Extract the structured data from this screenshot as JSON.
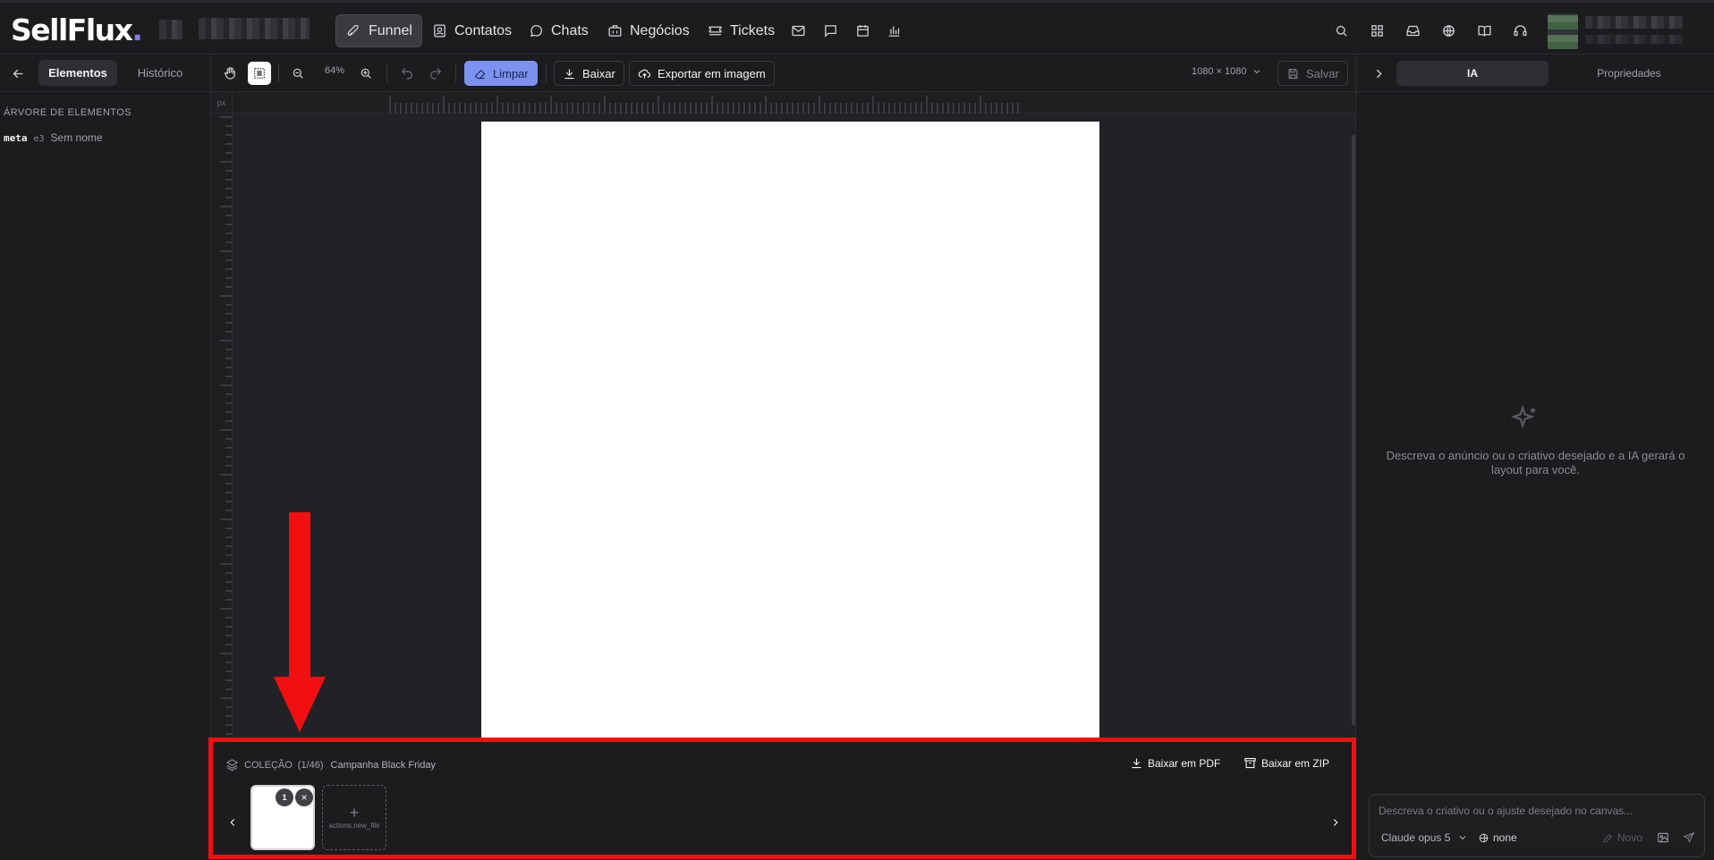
{
  "app": {
    "logo_main": "SellFlux",
    "logo_dot": "."
  },
  "nav": {
    "items": [
      {
        "label": "Funnel",
        "icon": "rocket-icon",
        "active": true
      },
      {
        "label": "Contatos",
        "icon": "contacts-icon"
      },
      {
        "label": "Chats",
        "icon": "chat-icon"
      },
      {
        "label": "Negócios",
        "icon": "briefcase-icon"
      },
      {
        "label": "Tickets",
        "icon": "ticket-icon"
      }
    ]
  },
  "left_panel": {
    "tabs": [
      {
        "label": "Elementos",
        "active": true
      },
      {
        "label": "Histórico"
      }
    ],
    "tree_title": "ÁRVORE DE ELEMENTOS",
    "tree_items": [
      {
        "type": "meta",
        "tag": "e3",
        "name": "Sem nome"
      }
    ]
  },
  "toolbar": {
    "zoom": "64%",
    "clear_label": "Limpar",
    "download_label": "Baixar",
    "export_label": "Exportar em imagem",
    "dimensions": "1080 × 1080",
    "save_label": "Salvar"
  },
  "ruler": {
    "corner": "px"
  },
  "collection": {
    "title": "COLEÇÃO",
    "counter": "(1/46)",
    "name": "Campanha Black Friday",
    "pdf_label": "Baixar em PDF",
    "zip_label": "Baixar em ZIP",
    "thumb_number": "1",
    "new_file_label": "actions.new_file"
  },
  "right_panel": {
    "tabs": [
      {
        "label": "IA",
        "active": true
      },
      {
        "label": "Propriedades"
      }
    ],
    "hint": "Descreva o anúncio ou o criativo desejado e a IA gerará o layout para você.",
    "prompt_placeholder": "Descreva o criativo ou o ajuste desejado no canvas...",
    "model": "Claude opus 5",
    "context": "none",
    "new_label": "Novo"
  },
  "colors": {
    "accent": "#7b93ef",
    "annotation": "#f10f0f"
  }
}
